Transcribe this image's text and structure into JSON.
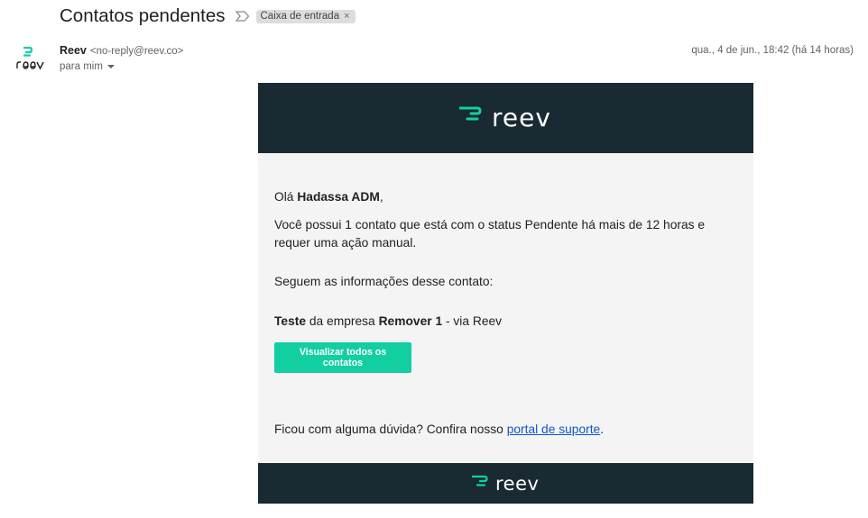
{
  "subject": {
    "title": "Contatos pendentes",
    "label": "Caixa de entrada",
    "label_close": "×"
  },
  "sender": {
    "name": "Reev",
    "email": "<no-reply@reev.co>",
    "to": "para mim",
    "date": "qua., 4 de jun., 18:42 (há 14 horas)",
    "avatar_icon": "reev-logo-icon"
  },
  "email": {
    "brand": "reev",
    "brand_color": "#12cfa2",
    "band_color": "#1a2a32",
    "greeting_prefix": "Olá ",
    "greeting_name": "Hadassa ADM",
    "greeting_suffix": ",",
    "message": "Você possui 1 contato que está com o status Pendente há mais de 12 horas e requer uma ação manual.",
    "info_intro": "Seguem as informações desse contato:",
    "contact_name": "Teste",
    "contact_mid": " da empresa ",
    "company_name": "Remover 1",
    "contact_suffix": " - via Reev",
    "button_label": "Visualizar todos os contatos",
    "support_prefix": "Ficou com alguma dúvida? Confira nosso ",
    "support_link": "portal de suporte",
    "support_suffix": "."
  }
}
